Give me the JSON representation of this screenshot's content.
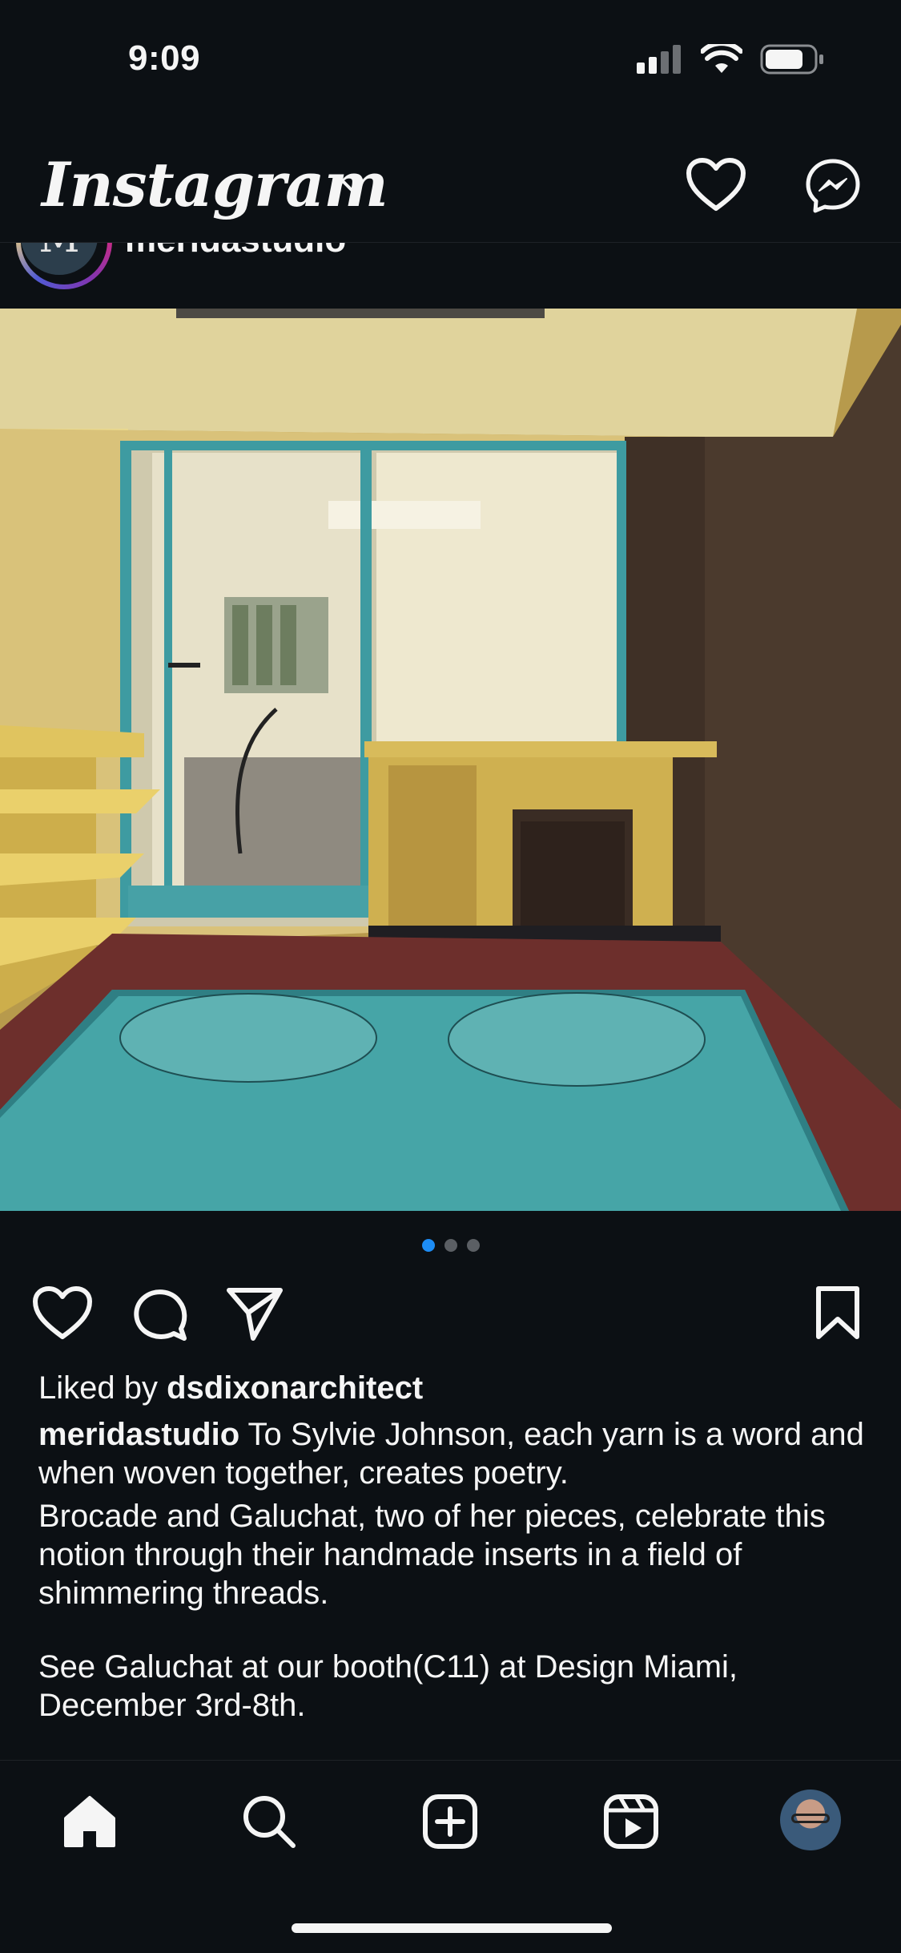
{
  "status_bar": {
    "time": "9:09",
    "icons": [
      "signal-icon",
      "wifi-icon",
      "battery-icon"
    ]
  },
  "header": {
    "logo_text": "Instagram",
    "icons": [
      "chevron-down-icon",
      "heart-icon",
      "messenger-icon"
    ]
  },
  "post": {
    "username": "meridastudio",
    "avatar_letter": "M",
    "more_label": "•••",
    "photo_subject": "modernist room",
    "carousel": {
      "count": 3,
      "active_index": 0
    },
    "liked_prefix": "Liked by ",
    "liked_user": "dsdixonarchitect",
    "caption_user": "meridastudio",
    "caption_first": " To Sylvie Johnson, each yarn is a word and when woven together, creates poetry.",
    "caption_second": "Brocade and Galuchat, two of her pieces, celebrate this notion through their handmade inserts in a field of shimmering threads.",
    "caption_third": "See Galuchat at our booth(C11) at Design Miami, December 3rd-8th."
  },
  "tab_bar": {
    "items": [
      "home-icon",
      "search-icon",
      "create-icon",
      "reels-icon",
      "profile-avatar"
    ]
  },
  "colors": {
    "background": "#0c1014",
    "text": "#f5f5f5",
    "accent_dot": "#1d8cf4"
  }
}
